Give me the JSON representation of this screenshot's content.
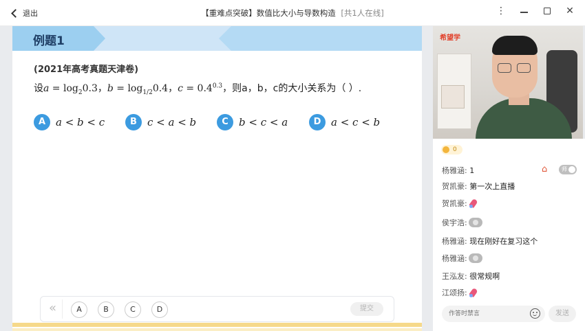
{
  "window": {
    "back_label": "退出",
    "title": "【重难点突破】数值比大小与导数构造",
    "online": "[共1人在线]",
    "menu_icon": "⋮",
    "close_icon": "✕"
  },
  "question": {
    "tag": "例题1",
    "source": "(2021年高考真题天津卷)",
    "stem_prefix": "设",
    "stem_a": "a",
    "stem_eq1": " = log",
    "stem_sub1": "2",
    "stem_val1": "0.3",
    "stem_sep1": "，",
    "stem_b": "b",
    "stem_eq2": " = log",
    "stem_sub2": "1/2",
    "stem_val2": "0.4",
    "stem_sep2": "，",
    "stem_c": "c",
    "stem_eq3": " = 0.4",
    "stem_sup3": "0.3",
    "stem_tail": "，则a，b，c的大小关系为（  ）.",
    "options": [
      {
        "letter": "A",
        "expr": "a < b < c"
      },
      {
        "letter": "B",
        "expr": "c < a < b"
      },
      {
        "letter": "C",
        "expr": "b < c < a"
      },
      {
        "letter": "D",
        "expr": "a < c < b"
      }
    ]
  },
  "answer_bar": {
    "collapse_icon": "«",
    "choices": [
      "A",
      "B",
      "C",
      "D"
    ],
    "submit": "提交"
  },
  "video": {
    "logo": "希望学"
  },
  "chat": {
    "likes": "0",
    "messages": [
      {
        "user": "杨雅涵:",
        "text": "1",
        "emoji": ""
      },
      {
        "user": "贺凯豪:",
        "text": "第一次上直播",
        "emoji": ""
      },
      {
        "user": "贺凯豪:",
        "text": "",
        "emoji": "rocket"
      },
      {
        "user": "侯宇浩:",
        "text": "",
        "emoji": "monkey"
      },
      {
        "user": "杨雅涵:",
        "text": "现在刚好在复习这个",
        "emoji": ""
      },
      {
        "user": "杨雅涵:",
        "text": "",
        "emoji": "monkey"
      },
      {
        "user": "王泓友:",
        "text": "很常规啊",
        "emoji": ""
      },
      {
        "user": "江颂扬:",
        "text": "",
        "emoji": "rocket"
      }
    ],
    "teacher_toggle": "师",
    "input_placeholder": "作答时禁言",
    "send": "发送"
  },
  "colors": {
    "accent": "#3c9be0",
    "header_bg": "#cfe5f7",
    "tag_bg": "#9ccff0",
    "progress": "#f6d98a"
  }
}
